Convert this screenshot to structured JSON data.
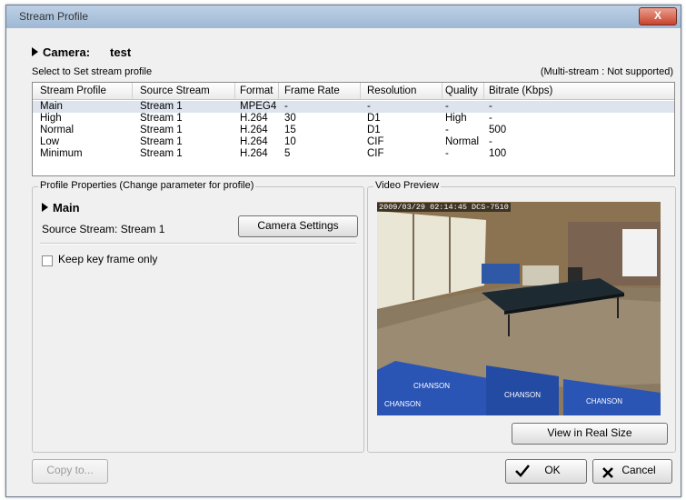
{
  "window": {
    "title": "Stream Profile",
    "close_label": "X"
  },
  "camera": {
    "label": "Camera:",
    "value": "test"
  },
  "select_label": "Select to Set stream profile",
  "multistream_note": "(Multi-stream : Not supported)",
  "table": {
    "headers": [
      "Stream Profile",
      "Source Stream",
      "Format",
      "Frame Rate",
      "Resolution",
      "Quality",
      "Bitrate (Kbps)"
    ],
    "rows": [
      [
        "Main",
        "Stream 1",
        "MPEG4",
        "-",
        "-",
        "-",
        "-"
      ],
      [
        "High",
        "Stream 1",
        "H.264",
        "30",
        "D1",
        "High",
        "-"
      ],
      [
        "Normal",
        "Stream 1",
        "H.264",
        "15",
        "D1",
        "-",
        "500"
      ],
      [
        "Low",
        "Stream 1",
        "H.264",
        "10",
        "CIF",
        "Normal",
        "-"
      ],
      [
        "Minimum",
        "Stream 1",
        "H.264",
        "5",
        "CIF",
        "-",
        "100"
      ]
    ],
    "selected_row": 0
  },
  "profile_properties": {
    "group_label": "Profile Properties (Change parameter for profile)",
    "profile_name": "Main",
    "source_stream": "Source Stream: Stream  1",
    "camera_settings_label": "Camera Settings",
    "keyframe_label": "Keep key frame only"
  },
  "video_preview": {
    "group_label": "Video Preview",
    "overlay": "2009/03/29 02:14:45 DCS-7510",
    "view_real_size_label": "View in Real Size",
    "banner_texts": [
      "CHANSON",
      "CHANSON",
      "CHANSON",
      "CHANSON"
    ]
  },
  "buttons": {
    "copy_to": "Copy to...",
    "ok": "OK",
    "cancel": "Cancel"
  }
}
